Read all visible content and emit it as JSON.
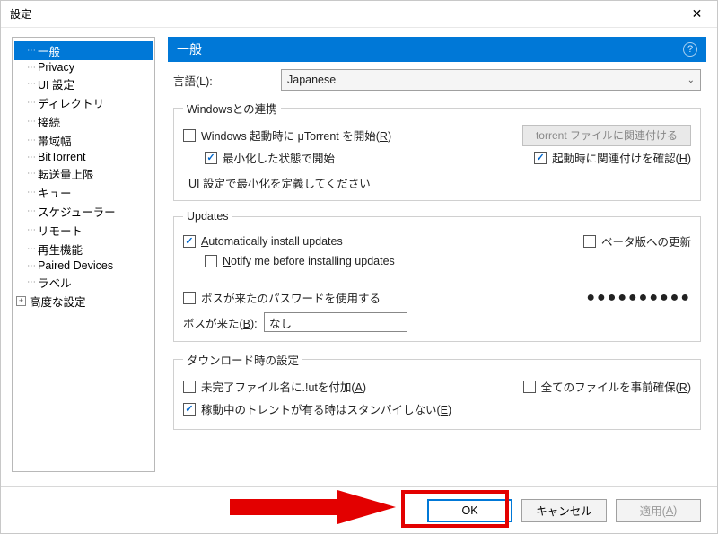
{
  "title": "設定",
  "sidebar": {
    "items": [
      {
        "label": "一般",
        "selected": true
      },
      {
        "label": "Privacy"
      },
      {
        "label": "UI 設定"
      },
      {
        "label": "ディレクトリ"
      },
      {
        "label": "接続"
      },
      {
        "label": "帯域幅"
      },
      {
        "label": "BitTorrent"
      },
      {
        "label": "転送量上限"
      },
      {
        "label": "キュー"
      },
      {
        "label": "スケジューラー"
      },
      {
        "label": "リモート"
      },
      {
        "label": "再生機能"
      },
      {
        "label": "Paired Devices"
      },
      {
        "label": "ラベル"
      },
      {
        "label": "高度な設定",
        "expandable": true
      }
    ]
  },
  "banner": {
    "title": "一般",
    "help": "?"
  },
  "language": {
    "label": "言語(L):",
    "value": "Japanese"
  },
  "windows": {
    "legend": "Windowsとの連携",
    "start_label_pre": "Windows 起動時に μTorrent を開始(",
    "start_key": "R",
    "start_label_post": ")",
    "start_minimized": "最小化した状態で開始",
    "ui_note": "UI 設定で最小化を定義してください",
    "associate_btn": "torrent ファイルに関連付ける",
    "check_assoc_pre": "起動時に関連付けを確認(",
    "check_assoc_key": "H",
    "check_assoc_post": ")"
  },
  "updates": {
    "legend": "Updates",
    "auto_pre": "A",
    "auto_post": "utomatically install updates",
    "beta": "ベータ版への更新",
    "notify_pre": "N",
    "notify_post": "otify me before installing updates",
    "boss_use": "ボスが来たのパスワードを使用する",
    "boss_label_pre": "ボスが来た(",
    "boss_key": "B",
    "boss_label_post": "):",
    "boss_value": "なし",
    "pw_mask": "●●●●●●●●●●"
  },
  "download": {
    "legend": "ダウンロード時の設定",
    "incomplete_pre": "未完了ファイル名に.!utを付加(",
    "incomplete_key": "A",
    "incomplete_post": ")",
    "prealloc_pre": "全てのファイルを事前確保(",
    "prealloc_key": "R",
    "prealloc_post": ")",
    "standby_pre": "稼動中のトレントが有る時はスタンバイしない(",
    "standby_key": "E",
    "standby_post": ")"
  },
  "buttons": {
    "ok": "OK",
    "cancel": "キャンセル",
    "apply_pre": "適用(",
    "apply_key": "A",
    "apply_post": ")"
  }
}
